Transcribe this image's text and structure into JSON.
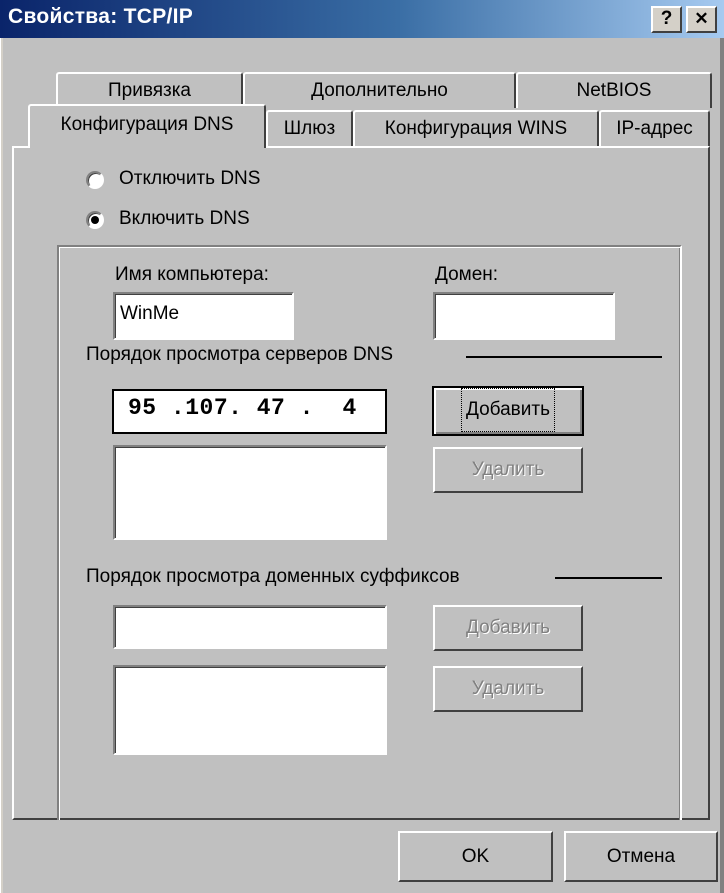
{
  "window": {
    "title": "Свойства: TCP/IP",
    "help_button": "?",
    "close_button": "✕"
  },
  "tabs": {
    "back_row": [
      {
        "label": "Привязка"
      },
      {
        "label": "Дополнительно"
      },
      {
        "label": "NetBIOS"
      }
    ],
    "front_row": [
      {
        "label": "Конфигурация DNS",
        "active": true
      },
      {
        "label": "Шлюз"
      },
      {
        "label": "Конфигурация WINS"
      },
      {
        "label": "IP-адрес"
      }
    ]
  },
  "dns": {
    "disable_label": "Отключить DNS",
    "enable_label": "Включить DNS",
    "selected": "enable",
    "host_label": "Имя компьютера:",
    "host_value": "WinMe",
    "domain_label": "Домен:",
    "domain_value": "",
    "server_order_label": "Порядок просмотра серверов DNS",
    "server_ip": "95 .107. 47 .  4",
    "server_add_label": "Добавить",
    "server_remove_label": "Удалить",
    "suffix_order_label": "Порядок просмотра доменных суффиксов",
    "suffix_add_label": "Добавить",
    "suffix_remove_label": "Удалить"
  },
  "footer": {
    "ok_label": "OK",
    "cancel_label": "Отмена"
  }
}
